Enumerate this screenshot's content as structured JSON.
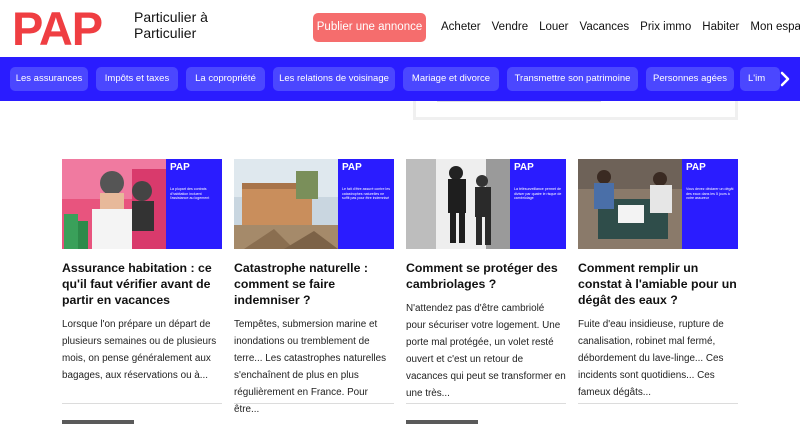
{
  "header": {
    "logo": "PAP",
    "tagline_line1": "Particulier à",
    "tagline_line2": "Particulier",
    "publish_label": "Publier une annonce",
    "nav": [
      "Acheter",
      "Vendre",
      "Louer",
      "Vacances",
      "Prix immo",
      "Habiter",
      "Mon espace"
    ]
  },
  "categories": [
    "Les assurances",
    "Impôts et taxes",
    "La copropriété",
    "Les relations de voisinage",
    "Mariage et divorce",
    "Transmettre son patrimoine",
    "Personnes agées",
    "L'im"
  ],
  "cards": [
    {
      "thumb_brand": "PAP",
      "thumb_text": "La plupart des contrats d'habitation incluent l'assistance au logement",
      "title": "Assurance habitation : ce qu'il faut vérifier avant de partir en vacances",
      "excerpt": "Lorsque l'on prépare un départ de plusieurs semaines ou de plusieurs mois, on pense généralement aux bagages, aux réservations ou à..."
    },
    {
      "thumb_brand": "PAP",
      "thumb_text": "Le fait d'être assuré contre les catastrophes naturelles ne suffit pas pour être indemnisé",
      "title": "Catastrophe naturelle : comment se faire indemniser ?",
      "excerpt": "Tempêtes, submersion marine et inondations ou tremblement de terre... Les catastrophes naturelles s'enchaînent de plus en plus régulièrement en France. Pour être..."
    },
    {
      "thumb_brand": "PAP",
      "thumb_text": "La télésurveillance permet de diviser par quatre le risque de cambriolage",
      "title": "Comment se protéger des cambriolages ?",
      "excerpt": "N'attendez pas d'être cambriolé pour sécuriser votre logement. Une porte mal protégée, un volet resté ouvert et c'est un retour de vacances qui peut se transformer en une très..."
    },
    {
      "thumb_brand": "PAP",
      "thumb_text": "Vous devez déclarer un dégât des eaux dans les 5 jours à votre assureur",
      "title": "Comment remplir un constat à l'amiable pour un dégât des eaux ?",
      "excerpt": "Fuite d'eau insidieuse, rupture de canalisation, robinet mal fermé, débordement du lave-linge... Ces incidents sont quotidiens... Ces fameux dégâts..."
    }
  ],
  "colors": {
    "brand_red": "#ef3e42",
    "publish_bg": "#f56d6d",
    "bar_blue": "#2a1cff",
    "chip_blue": "#4b47ff"
  }
}
